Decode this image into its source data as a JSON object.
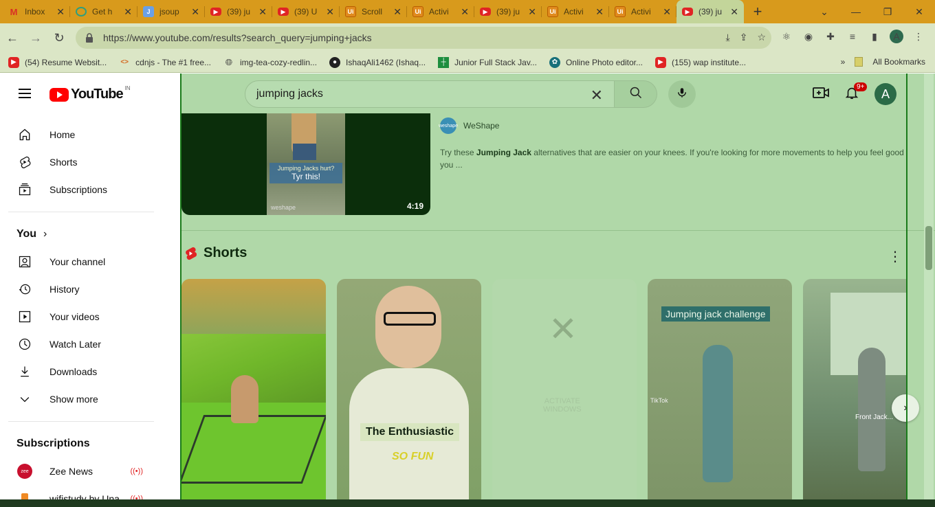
{
  "browser": {
    "tabs": [
      {
        "title": "Inbox",
        "icon": "gmail-icon"
      },
      {
        "title": "Get h",
        "icon": "chatgpt-icon"
      },
      {
        "title": "jsoup",
        "icon": "jsoup-icon"
      },
      {
        "title": "(39) ju",
        "icon": "youtube-icon"
      },
      {
        "title": "(39) U",
        "icon": "youtube-icon"
      },
      {
        "title": "Scroll",
        "icon": "uiverse-icon"
      },
      {
        "title": "Activi",
        "icon": "uiverse-icon"
      },
      {
        "title": "(39) ju",
        "icon": "youtube-icon"
      },
      {
        "title": "Activi",
        "icon": "uiverse-icon"
      },
      {
        "title": "Activi",
        "icon": "uiverse-icon"
      },
      {
        "title": "(39) ju",
        "icon": "youtube-icon",
        "active": true
      }
    ],
    "url": "https://www.youtube.com/results?search_query=jumping+jacks",
    "profile_initial": "A",
    "bookmarks": [
      {
        "label": "(54) Resume Websit...",
        "icon": "youtube-icon"
      },
      {
        "label": "cdnjs - The #1 free...",
        "icon": "cdnjs-icon"
      },
      {
        "label": "img-tea-cozy-redlin...",
        "icon": "globe-icon"
      },
      {
        "label": "IshaqAli1462 (Ishaq...",
        "icon": "github-icon"
      },
      {
        "label": "Junior Full Stack Jav...",
        "icon": "sheet-icon"
      },
      {
        "label": "Online Photo editor...",
        "icon": "photo-editor-icon"
      },
      {
        "label": "(155) wap institute...",
        "icon": "youtube-icon"
      }
    ],
    "all_bookmarks": "All Bookmarks"
  },
  "youtube": {
    "logo_text": "YouTube",
    "country": "IN",
    "search_query": "jumping jacks",
    "notification_count": "9+",
    "avatar_initial": "A",
    "nav_main": [
      {
        "label": "Home",
        "icon": "home-icon"
      },
      {
        "label": "Shorts",
        "icon": "shorts-icon"
      },
      {
        "label": "Subscriptions",
        "icon": "subscriptions-icon"
      }
    ],
    "you_label": "You",
    "nav_you": [
      {
        "label": "Your channel",
        "icon": "channel-icon"
      },
      {
        "label": "History",
        "icon": "history-icon"
      },
      {
        "label": "Your videos",
        "icon": "your-videos-icon"
      },
      {
        "label": "Watch Later",
        "icon": "watch-later-icon"
      },
      {
        "label": "Downloads",
        "icon": "download-icon"
      },
      {
        "label": "Show more",
        "icon": "chevron-down-icon"
      }
    ],
    "subscriptions_title": "Subscriptions",
    "subscriptions": [
      {
        "label": "Zee News",
        "live": true
      },
      {
        "label": "wifistudy by Una...",
        "live": true
      }
    ],
    "video": {
      "channel": "WeShape",
      "channel_avatar_text": "weshape",
      "duration": "4:19",
      "thumb_caption_top": "Jumping Jacks hurt?",
      "thumb_caption_main": "Tyr this!",
      "thumb_brand": "weshape",
      "desc_prefix": "Try these ",
      "desc_bold": "Jumping Jack",
      "desc_suffix": " alternatives that are easier on your knees. If you're looking for more movements to help you feel good you ..."
    },
    "shorts_title": "Shorts",
    "shorts": [
      {
        "caption": ""
      },
      {
        "caption": "The Enthusiastic",
        "sub": "SO FUN"
      },
      {
        "caption": "ACTIVATE",
        "sub": "WINDOWS"
      },
      {
        "caption": "Jumping jack challenge",
        "sub": "TikTok"
      },
      {
        "caption": "Front Jack..."
      }
    ]
  }
}
